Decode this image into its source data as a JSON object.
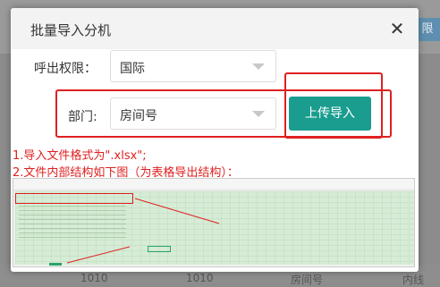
{
  "background": {
    "tab_label": "限",
    "row_values": [
      "1010",
      "1010",
      "房间号",
      "内线"
    ]
  },
  "dialog": {
    "title": "批量导入分机",
    "close_icon": "close-icon",
    "permission": {
      "label": "呼出权限：",
      "value": "国际"
    },
    "department": {
      "label": "部门:",
      "value": "房间号"
    },
    "upload_button": "上传导入",
    "instructions": [
      "1.导入文件格式为\".xlsx\";",
      "2.文件内部结构如下图（为表格导出结构）："
    ],
    "preview_icon": "spreadsheet-preview-image"
  },
  "colors": {
    "accent": "#1a9d8f",
    "annotation": "#e02020"
  }
}
